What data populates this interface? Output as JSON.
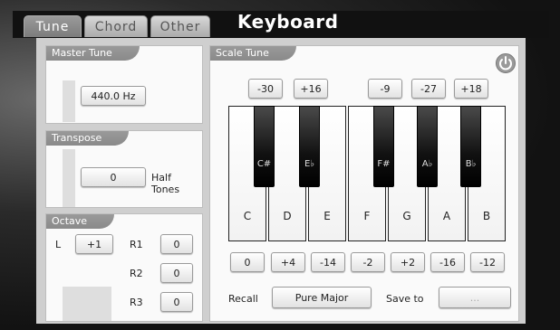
{
  "tabs": [
    {
      "label": "Tune",
      "active": true
    },
    {
      "label": "Chord",
      "active": false
    },
    {
      "label": "Other",
      "active": false
    }
  ],
  "app_title": "Keyboard",
  "master_tune": {
    "title": "Master Tune",
    "value": "440.0 Hz"
  },
  "transpose": {
    "title": "Transpose",
    "value": "0",
    "unit": "Half Tones"
  },
  "octave": {
    "title": "Octave",
    "left_label": "L",
    "left_value": "+1",
    "rows": [
      {
        "label": "R1",
        "value": "0"
      },
      {
        "label": "R2",
        "value": "0"
      },
      {
        "label": "R3",
        "value": "0"
      }
    ]
  },
  "scale_tune": {
    "title": "Scale Tune",
    "power_icon": "power-icon",
    "black_values": [
      "-30",
      "+16",
      "-9",
      "-27",
      "+18"
    ],
    "black_keys": [
      "C#",
      "E♭",
      "F#",
      "A♭",
      "B♭"
    ],
    "white_keys": [
      "C",
      "D",
      "E",
      "F",
      "G",
      "A",
      "B"
    ],
    "white_values": [
      "0",
      "+4",
      "-14",
      "-2",
      "+2",
      "-16",
      "-12"
    ],
    "recall_label": "Recall",
    "recall_value": "Pure Major",
    "save_label": "Save to",
    "save_value": "..."
  }
}
